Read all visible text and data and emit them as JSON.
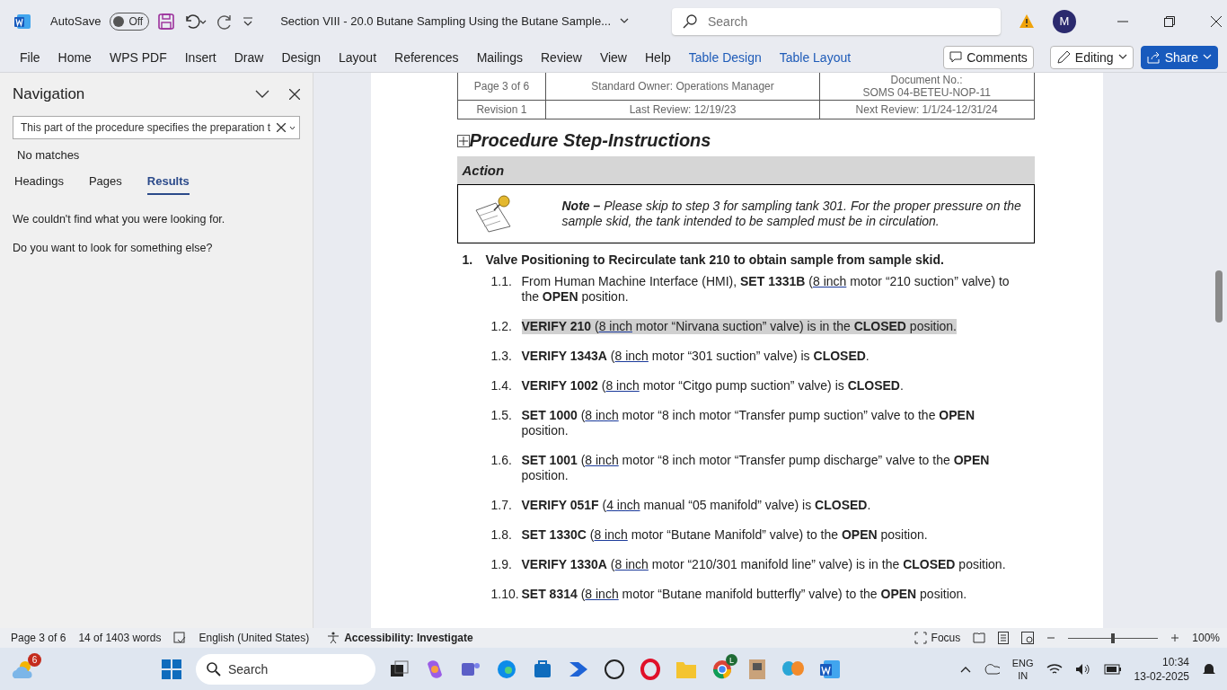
{
  "titlebar": {
    "autosave_label": "AutoSave",
    "autosave": {
      "on": false,
      "label": "Off"
    },
    "document_title": "Section VIII - 20.0 Butane Sampling Using the Butane Sample...",
    "search_placeholder": "Search",
    "avatar": "M"
  },
  "ribbon": {
    "tabs": [
      {
        "label": "File",
        "kind": "plain"
      },
      {
        "label": "Home",
        "kind": "plain"
      },
      {
        "label": "WPS PDF",
        "kind": "plain"
      },
      {
        "label": "Insert",
        "kind": "plain"
      },
      {
        "label": "Draw",
        "kind": "plain"
      },
      {
        "label": "Design",
        "kind": "plain"
      },
      {
        "label": "Layout",
        "kind": "plain"
      },
      {
        "label": "References",
        "kind": "plain"
      },
      {
        "label": "Mailings",
        "kind": "plain"
      },
      {
        "label": "Review",
        "kind": "plain"
      },
      {
        "label": "View",
        "kind": "plain"
      },
      {
        "label": "Help",
        "kind": "plain"
      },
      {
        "label": "Table Design",
        "kind": "contextual"
      },
      {
        "label": "Table Layout",
        "kind": "contextual"
      }
    ],
    "comments": "Comments",
    "editing": "Editing",
    "share": "Share"
  },
  "navigation": {
    "title": "Navigation",
    "search_value": "This part of the procedure specifies the preparation t",
    "status": "No matches",
    "tabs": [
      {
        "label": "Headings",
        "selected": false
      },
      {
        "label": "Pages",
        "selected": false
      },
      {
        "label": "Results",
        "selected": true
      }
    ],
    "messages": [
      "We couldn't find what you were looking for.",
      "Do you want to look for something else?"
    ]
  },
  "document": {
    "header_rows": [
      [
        "Page 3 of 6",
        "Standard Owner: Operations Manager",
        "Document No.:\nSOMS 04-BETEU-NOP-11"
      ],
      [
        "Revision 1",
        "Last Review: 12/19/23",
        "Next Review: 1/1/24-12/31/24"
      ]
    ],
    "heading": "Procedure Step-Instructions",
    "action_header": "Action",
    "note": "**Note –** Please skip to step 3 for sampling tank 301. For the proper pressure on the sample skid, the tank intended to be sampled must be in circulation.",
    "step": {
      "number": "1.",
      "text": "Valve Positioning to Recirculate tank 210 to obtain sample from sample skid."
    },
    "substeps": [
      {
        "number": "1.1.",
        "before": "From Human Machine Interface (HMI), **SET 1331B** (",
        "link": "8 inch",
        "after": " motor “210 suction” valve) to the **OPEN** position.",
        "highlighted": false
      },
      {
        "number": "1.2.",
        "before": "**VERIFY 210** (",
        "link": "8 inch",
        "after": " motor “Nirvana suction” valve) is in the **CLOSED** position.",
        "highlighted": true
      },
      {
        "number": "1.3.",
        "before": "**VERIFY 1343A** (",
        "link": "8 inch",
        "after": " motor “301 suction” valve) is **CLOSED**.",
        "highlighted": false
      },
      {
        "number": "1.4.",
        "before": "**VERIFY 1002** (",
        "link": "8 inch",
        "after": " motor “Citgo pump suction” valve) is **CLOSED**.",
        "highlighted": false
      },
      {
        "number": "1.5.",
        "before": "**SET 1000** (",
        "link": "8 inch",
        "after": " motor “8 inch motor “Transfer pump suction” valve to the **OPEN** position.",
        "highlighted": false
      },
      {
        "number": "1.6.",
        "before": "**SET 1001** (",
        "link": "8 inch",
        "after": " motor “8 inch motor “Transfer pump discharge” valve to the **OPEN** position.",
        "highlighted": false
      },
      {
        "number": "1.7.",
        "before": "**VERIFY 051F** (",
        "link": "4 inch",
        "after": " manual “05 manifold” valve) is **CLOSED**.",
        "highlighted": false
      },
      {
        "number": "1.8.",
        "before": "**SET 1330C** (",
        "link": "8 inch",
        "after": " motor “Butane Manifold” valve) to the **OPEN** position.",
        "highlighted": false
      },
      {
        "number": "1.9.",
        "before": "**VERIFY 1330A** (",
        "link": "8 inch",
        "after": " motor “210/301 manifold line” valve) is in the **CLOSED** position.",
        "highlighted": false
      },
      {
        "number": "1.10.",
        "before": "**SET 8314** (",
        "link": "8 inch",
        "after": " motor “Butane manifold butterfly” valve) to the **OPEN** position.",
        "highlighted": false
      }
    ]
  },
  "status_bar": {
    "page": "Page 3 of 6",
    "words": "14 of 1403 words",
    "language": "English (United States)",
    "accessibility": "Accessibility: Investigate",
    "focus": "Focus",
    "zoom": {
      "level": 0.5
    },
    "zoom_percent": "100%"
  },
  "taskbar": {
    "weather_badge": "6",
    "search_placeholder": "Search",
    "browser_badge": "L",
    "language": "ENG",
    "region": "IN",
    "time": "10:34",
    "date": "13-02-2025"
  }
}
